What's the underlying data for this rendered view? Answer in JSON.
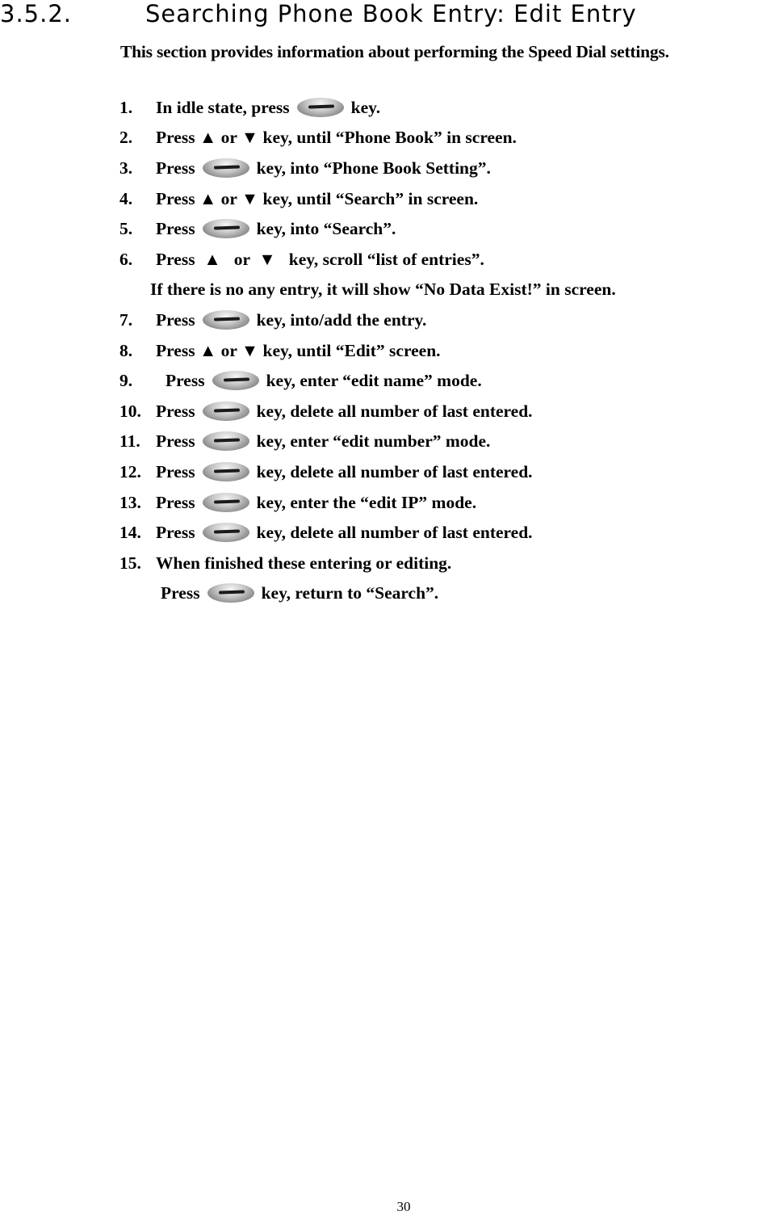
{
  "heading": {
    "number": "3.5.2.",
    "title": "Searching Phone Book Entry: Edit Entry"
  },
  "intro": "This section provides information about performing the Speed Dial settings.",
  "key_icon": "menu-ok-key-icon",
  "steps": [
    {
      "num": "1.",
      "before": "In idle state, press",
      "after": "key."
    },
    {
      "num": "2.",
      "text": "Press ▲ or ▼ key, until “Phone Book” in screen."
    },
    {
      "num": "3.",
      "before": "Press",
      "after": "key, into “Phone Book Setting”."
    },
    {
      "num": "4.",
      "text": "Press ▲ or ▼ key, until “Search” in screen."
    },
    {
      "num": "5.",
      "before": "Press",
      "after": "key, into “Search”."
    },
    {
      "num": "6.",
      "text": "Press  ▲   or  ▼   key, scroll “list of entries”."
    },
    {
      "note": "If there is no any entry, it will show “No Data Exist!” in screen."
    },
    {
      "num": "7.",
      "before": "Press",
      "after": "key, into/add the entry."
    },
    {
      "num": "8.",
      "text": "Press ▲ or ▼ key, until “Edit” screen."
    },
    {
      "num": "9.",
      "before": "Press",
      "after": "key, enter “edit name” mode."
    },
    {
      "num": "10.",
      "before": "Press",
      "after": "key, delete all number of last entered."
    },
    {
      "num": "11.",
      "before": "Press",
      "after": "key, enter “edit number” mode."
    },
    {
      "num": "12.",
      "before": "Press",
      "after": "key, delete all number of last entered."
    },
    {
      "num": "13.",
      "before": "Press",
      "after": "key, enter the “edit IP” mode."
    },
    {
      "num": "14.",
      "before": "Press",
      "after": "key, delete all number of last entered."
    },
    {
      "num": "15.",
      "text": "When finished these entering or editing."
    },
    {
      "cont_before": "Press",
      "cont_after": "key, return to “Search”."
    }
  ],
  "page_number": "30"
}
